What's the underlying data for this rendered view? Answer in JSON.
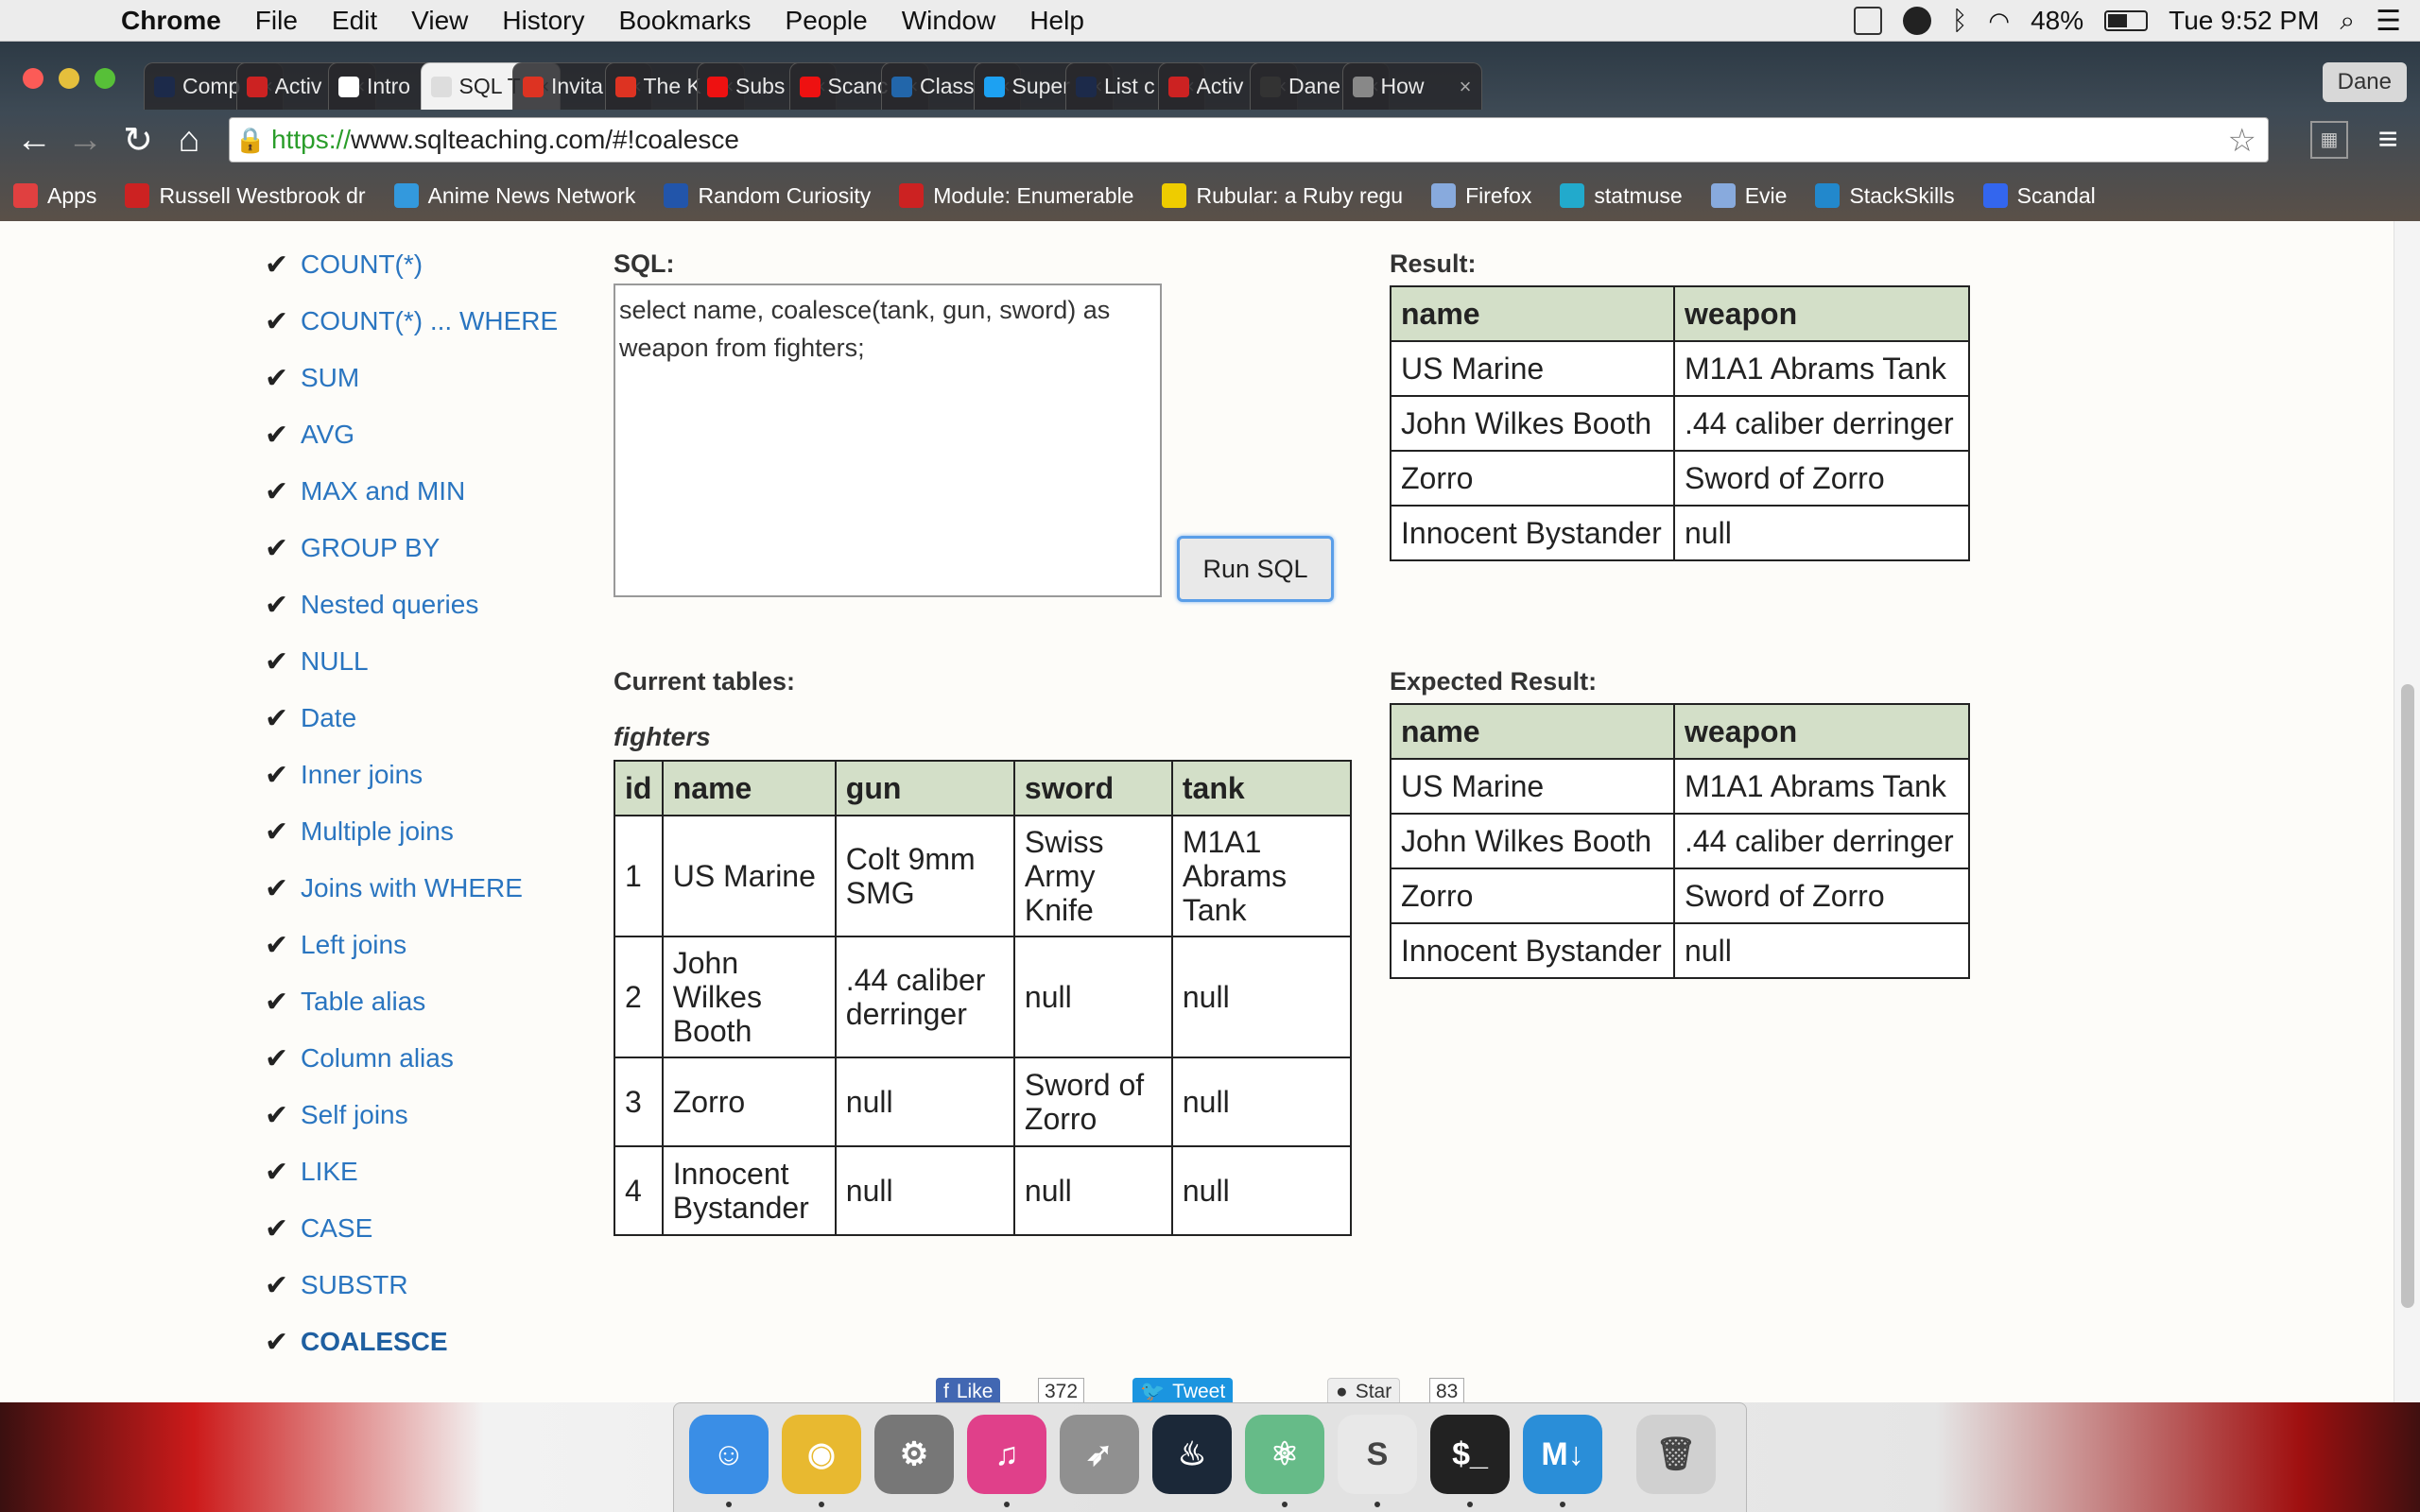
{
  "menubar": {
    "app": "Chrome",
    "items": [
      "File",
      "Edit",
      "View",
      "History",
      "Bookmarks",
      "People",
      "Window",
      "Help"
    ],
    "battery": "48%",
    "clock": "Tue 9:52 PM"
  },
  "tabs": [
    {
      "label": "Comp",
      "color": "#1c2a4a"
    },
    {
      "label": "Activ",
      "color": "#cc2222"
    },
    {
      "label": "Intro",
      "color": "#ffffff"
    },
    {
      "label": "SQL T",
      "color": "#dddddd"
    },
    {
      "label": "Invita",
      "color": "#dd3322"
    },
    {
      "label": "The K",
      "color": "#dd3322"
    },
    {
      "label": "Subs",
      "color": "#ee1111"
    },
    {
      "label": "Scanc",
      "color": "#ee1111"
    },
    {
      "label": "Class",
      "color": "#2266aa"
    },
    {
      "label": "Super",
      "color": "#1da1f2"
    },
    {
      "label": "List c",
      "color": "#1c2a4a"
    },
    {
      "label": "Activ",
      "color": "#cc2222"
    },
    {
      "label": "Dane",
      "color": "#333333"
    },
    {
      "label": "How",
      "color": "#888888"
    }
  ],
  "profile": "Dane",
  "omnibox": {
    "scheme": "https://",
    "host_path": "www.sqlteaching.com/#!coalesce"
  },
  "bookmarks": [
    {
      "label": "Apps",
      "color": "#e04040"
    },
    {
      "label": "Russell Westbrook dr",
      "color": "#cc2222"
    },
    {
      "label": "Anime News Network",
      "color": "#3399dd"
    },
    {
      "label": "Random Curiosity",
      "color": "#2255aa"
    },
    {
      "label": "Module: Enumerable",
      "color": "#cc2222"
    },
    {
      "label": "Rubular: a Ruby regu",
      "color": "#eecc00"
    },
    {
      "label": "Firefox",
      "color": "#88aadd"
    },
    {
      "label": "statmuse",
      "color": "#22aacc"
    },
    {
      "label": "Evie",
      "color": "#88aadd"
    },
    {
      "label": "StackSkills",
      "color": "#2288cc"
    },
    {
      "label": "Scandal",
      "color": "#3366ee"
    }
  ],
  "sidebar": [
    "COUNT(*)",
    "COUNT(*) ... WHERE",
    "SUM",
    "AVG",
    "MAX and MIN",
    "GROUP BY",
    "Nested queries",
    "NULL",
    "Date",
    "Inner joins",
    "Multiple joins",
    "Joins with WHERE",
    "Left joins",
    "Table alias",
    "Column alias",
    "Self joins",
    "LIKE",
    "CASE",
    "SUBSTR",
    "COALESCE"
  ],
  "sql": {
    "label": "SQL:",
    "query": "select name, coalesce(tank, gun, sword) as weapon from fighters;",
    "run_label": "Run SQL"
  },
  "result": {
    "label": "Result:",
    "headers": [
      "name",
      "weapon"
    ],
    "rows": [
      [
        "US Marine",
        "M1A1 Abrams Tank"
      ],
      [
        "John Wilkes Booth",
        ".44 caliber derringer"
      ],
      [
        "Zorro",
        "Sword of Zorro"
      ],
      [
        "Innocent Bystander",
        "null"
      ]
    ]
  },
  "current_tables": {
    "label": "Current tables:",
    "table_name": "fighters",
    "headers": [
      "id",
      "name",
      "gun",
      "sword",
      "tank"
    ],
    "rows": [
      [
        [
          "1"
        ],
        [
          "US Marine"
        ],
        [
          "Colt 9mm",
          "SMG"
        ],
        [
          "Swiss",
          "Army",
          "Knife"
        ],
        [
          "M1A1",
          "Abrams",
          "Tank"
        ]
      ],
      [
        [
          "2"
        ],
        [
          "John",
          "Wilkes",
          "Booth"
        ],
        [
          ".44 caliber",
          "derringer"
        ],
        [
          "null"
        ],
        [
          "null"
        ]
      ],
      [
        [
          "3"
        ],
        [
          "Zorro"
        ],
        [
          "null"
        ],
        [
          "Sword of",
          "Zorro"
        ],
        [
          "null"
        ]
      ],
      [
        [
          "4"
        ],
        [
          "Innocent",
          "Bystander"
        ],
        [
          "null"
        ],
        [
          "null"
        ],
        [
          "null"
        ]
      ]
    ]
  },
  "expected": {
    "label": "Expected Result:",
    "headers": [
      "name",
      "weapon"
    ],
    "rows": [
      [
        "US Marine",
        "M1A1 Abrams Tank"
      ],
      [
        "John Wilkes Booth",
        ".44 caliber derringer"
      ],
      [
        "Zorro",
        "Sword of Zorro"
      ],
      [
        "Innocent Bystander",
        "null"
      ]
    ]
  },
  "social": {
    "like": "Like",
    "like_count": "372",
    "tweet": "Tweet",
    "star": "Star",
    "star_count": "83"
  },
  "dock": [
    {
      "name": "finder-icon",
      "color": "#3a8ee6",
      "glyph": "☺"
    },
    {
      "name": "chrome-icon",
      "color": "#e8b930",
      "glyph": "◉"
    },
    {
      "name": "system-preferences-icon",
      "color": "#777777",
      "glyph": "⚙"
    },
    {
      "name": "itunes-icon",
      "color": "#e0408a",
      "glyph": "♫"
    },
    {
      "name": "launchpad-icon",
      "color": "#909090",
      "glyph": "➶"
    },
    {
      "name": "steam-icon",
      "color": "#1b2838",
      "glyph": "♨"
    },
    {
      "name": "atom-icon",
      "color": "#66bb88",
      "glyph": "⚛"
    },
    {
      "name": "slack-icon",
      "color": "#e8e8e8",
      "glyph": "S"
    },
    {
      "name": "terminal-icon",
      "color": "#222222",
      "glyph": "$_"
    },
    {
      "name": "markdown-icon",
      "color": "#2a8ed8",
      "glyph": "M↓"
    },
    {
      "name": "trash-icon",
      "color": "#d0d0d0",
      "glyph": "🗑"
    }
  ]
}
